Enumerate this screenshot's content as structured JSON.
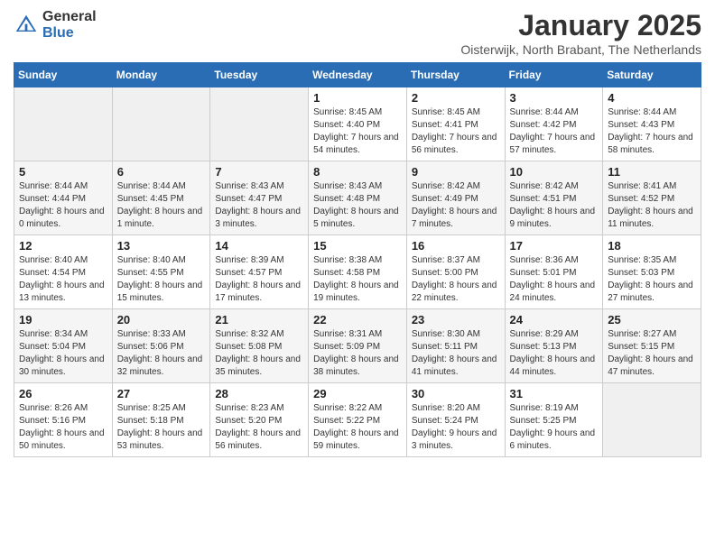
{
  "header": {
    "logo_general": "General",
    "logo_blue": "Blue",
    "title": "January 2025",
    "subtitle": "Oisterwijk, North Brabant, The Netherlands"
  },
  "days_of_week": [
    "Sunday",
    "Monday",
    "Tuesday",
    "Wednesday",
    "Thursday",
    "Friday",
    "Saturday"
  ],
  "weeks": [
    [
      {
        "day": "",
        "content": ""
      },
      {
        "day": "",
        "content": ""
      },
      {
        "day": "",
        "content": ""
      },
      {
        "day": "1",
        "content": "Sunrise: 8:45 AM\nSunset: 4:40 PM\nDaylight: 7 hours and 54 minutes."
      },
      {
        "day": "2",
        "content": "Sunrise: 8:45 AM\nSunset: 4:41 PM\nDaylight: 7 hours and 56 minutes."
      },
      {
        "day": "3",
        "content": "Sunrise: 8:44 AM\nSunset: 4:42 PM\nDaylight: 7 hours and 57 minutes."
      },
      {
        "day": "4",
        "content": "Sunrise: 8:44 AM\nSunset: 4:43 PM\nDaylight: 7 hours and 58 minutes."
      }
    ],
    [
      {
        "day": "5",
        "content": "Sunrise: 8:44 AM\nSunset: 4:44 PM\nDaylight: 8 hours and 0 minutes."
      },
      {
        "day": "6",
        "content": "Sunrise: 8:44 AM\nSunset: 4:45 PM\nDaylight: 8 hours and 1 minute."
      },
      {
        "day": "7",
        "content": "Sunrise: 8:43 AM\nSunset: 4:47 PM\nDaylight: 8 hours and 3 minutes."
      },
      {
        "day": "8",
        "content": "Sunrise: 8:43 AM\nSunset: 4:48 PM\nDaylight: 8 hours and 5 minutes."
      },
      {
        "day": "9",
        "content": "Sunrise: 8:42 AM\nSunset: 4:49 PM\nDaylight: 8 hours and 7 minutes."
      },
      {
        "day": "10",
        "content": "Sunrise: 8:42 AM\nSunset: 4:51 PM\nDaylight: 8 hours and 9 minutes."
      },
      {
        "day": "11",
        "content": "Sunrise: 8:41 AM\nSunset: 4:52 PM\nDaylight: 8 hours and 11 minutes."
      }
    ],
    [
      {
        "day": "12",
        "content": "Sunrise: 8:40 AM\nSunset: 4:54 PM\nDaylight: 8 hours and 13 minutes."
      },
      {
        "day": "13",
        "content": "Sunrise: 8:40 AM\nSunset: 4:55 PM\nDaylight: 8 hours and 15 minutes."
      },
      {
        "day": "14",
        "content": "Sunrise: 8:39 AM\nSunset: 4:57 PM\nDaylight: 8 hours and 17 minutes."
      },
      {
        "day": "15",
        "content": "Sunrise: 8:38 AM\nSunset: 4:58 PM\nDaylight: 8 hours and 19 minutes."
      },
      {
        "day": "16",
        "content": "Sunrise: 8:37 AM\nSunset: 5:00 PM\nDaylight: 8 hours and 22 minutes."
      },
      {
        "day": "17",
        "content": "Sunrise: 8:36 AM\nSunset: 5:01 PM\nDaylight: 8 hours and 24 minutes."
      },
      {
        "day": "18",
        "content": "Sunrise: 8:35 AM\nSunset: 5:03 PM\nDaylight: 8 hours and 27 minutes."
      }
    ],
    [
      {
        "day": "19",
        "content": "Sunrise: 8:34 AM\nSunset: 5:04 PM\nDaylight: 8 hours and 30 minutes."
      },
      {
        "day": "20",
        "content": "Sunrise: 8:33 AM\nSunset: 5:06 PM\nDaylight: 8 hours and 32 minutes."
      },
      {
        "day": "21",
        "content": "Sunrise: 8:32 AM\nSunset: 5:08 PM\nDaylight: 8 hours and 35 minutes."
      },
      {
        "day": "22",
        "content": "Sunrise: 8:31 AM\nSunset: 5:09 PM\nDaylight: 8 hours and 38 minutes."
      },
      {
        "day": "23",
        "content": "Sunrise: 8:30 AM\nSunset: 5:11 PM\nDaylight: 8 hours and 41 minutes."
      },
      {
        "day": "24",
        "content": "Sunrise: 8:29 AM\nSunset: 5:13 PM\nDaylight: 8 hours and 44 minutes."
      },
      {
        "day": "25",
        "content": "Sunrise: 8:27 AM\nSunset: 5:15 PM\nDaylight: 8 hours and 47 minutes."
      }
    ],
    [
      {
        "day": "26",
        "content": "Sunrise: 8:26 AM\nSunset: 5:16 PM\nDaylight: 8 hours and 50 minutes."
      },
      {
        "day": "27",
        "content": "Sunrise: 8:25 AM\nSunset: 5:18 PM\nDaylight: 8 hours and 53 minutes."
      },
      {
        "day": "28",
        "content": "Sunrise: 8:23 AM\nSunset: 5:20 PM\nDaylight: 8 hours and 56 minutes."
      },
      {
        "day": "29",
        "content": "Sunrise: 8:22 AM\nSunset: 5:22 PM\nDaylight: 8 hours and 59 minutes."
      },
      {
        "day": "30",
        "content": "Sunrise: 8:20 AM\nSunset: 5:24 PM\nDaylight: 9 hours and 3 minutes."
      },
      {
        "day": "31",
        "content": "Sunrise: 8:19 AM\nSunset: 5:25 PM\nDaylight: 9 hours and 6 minutes."
      },
      {
        "day": "",
        "content": ""
      }
    ]
  ]
}
